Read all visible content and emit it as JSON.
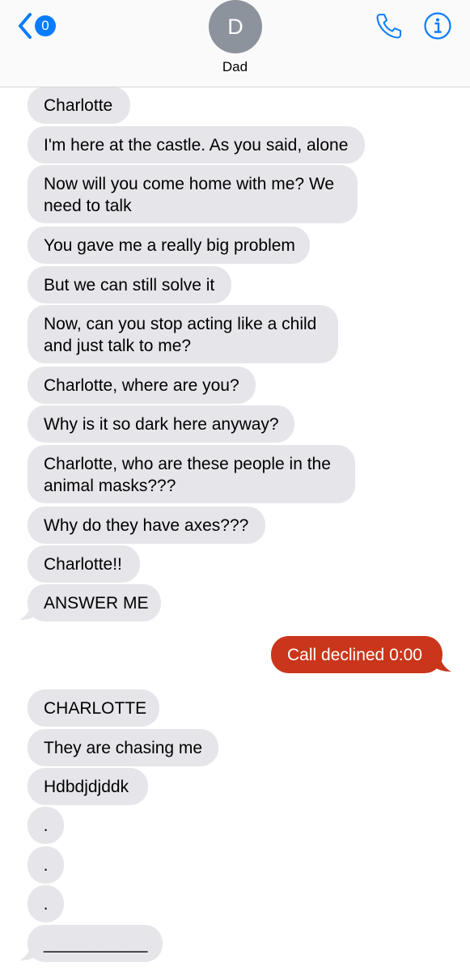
{
  "header": {
    "back_badge": "0",
    "avatar_initial": "D",
    "contact_name": "Dad",
    "icons": [
      "chevron-left-icon",
      "phone-icon",
      "info-icon"
    ],
    "accent_color": "#0a7cff"
  },
  "messages": [
    {
      "dir": "in",
      "text": "Charlotte"
    },
    {
      "dir": "in",
      "text": "I'm here at the castle. As you said, alone"
    },
    {
      "dir": "in",
      "text": "Now will you come home with me? We need to talk"
    },
    {
      "dir": "in",
      "text": "You gave me a really big problem"
    },
    {
      "dir": "in",
      "text": "But we can still solve it"
    },
    {
      "dir": "in",
      "text": "Now, can you stop acting like a child and just talk to me?"
    },
    {
      "dir": "in",
      "text": "Charlotte, where are you?"
    },
    {
      "dir": "in",
      "text": "Why is it so dark here anyway?"
    },
    {
      "dir": "in",
      "text": "Charlotte, who are these people in the animal masks???"
    },
    {
      "dir": "in",
      "text": "Why do they have axes???"
    },
    {
      "dir": "in",
      "text": "Charlotte!!"
    },
    {
      "dir": "in",
      "text": "ANSWER ME"
    },
    {
      "dir": "out",
      "text": "Call declined 0:00"
    },
    {
      "dir": "in",
      "text": "CHARLOTTE"
    },
    {
      "dir": "in",
      "text": "They are chasing me"
    },
    {
      "dir": "in",
      "text": "Hdbdjdjddk"
    },
    {
      "dir": "in",
      "text": "."
    },
    {
      "dir": "in",
      "text": "."
    },
    {
      "dir": "in",
      "text": "."
    },
    {
      "dir": "in",
      "text": "___________"
    }
  ],
  "colors": {
    "incoming_bubble": "#e5e5ea",
    "outgoing_bubble": "#c9361b"
  }
}
